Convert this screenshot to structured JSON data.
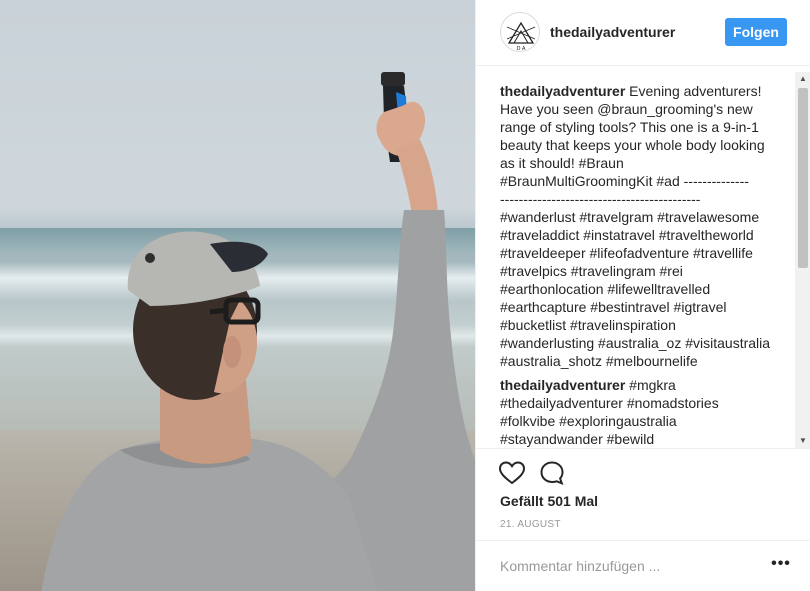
{
  "post": {
    "username": "thedailyadventurer",
    "follow_label": "Folgen",
    "avatar_text": "D A"
  },
  "comments": [
    {
      "username": "thedailyadventurer",
      "lines": [
        "Evening adventurers!",
        "Have you seen @braun_grooming's new",
        "range of styling tools? This one is a 9-in-1",
        "beauty that keeps your whole body looking",
        "as it should! #Braun",
        "#BraunMultiGroomingKit #ad --------------",
        "-------------------------------------------",
        "#wanderlust #travelgram #travelawesome",
        "#traveladdict #instatravel #traveltheworld",
        "#traveldeeper #lifeofadventure #travellife",
        "#travelpics #travelingram #rei",
        "#earthonlocation #lifewelltravelled",
        "#earthcapture #bestintravel #igtravel",
        "#bucketlist #travelinspiration",
        "#wanderlusting #australia_oz #visitaustralia",
        "#australia_shotz #melbournelife"
      ]
    },
    {
      "username": "thedailyadventurer",
      "lines": [
        "#mgkra",
        "#thedailyadventurer #nomadstories",
        "#folkvibe #exploringaustralia",
        "#stayandwander #bewild"
      ]
    }
  ],
  "actions": {
    "like_icon": "heart-icon",
    "comment_icon": "speech-bubble-icon",
    "likes_text": "Gefällt 501 Mal",
    "date_text": "21. AUGUST"
  },
  "add_comment": {
    "placeholder": "Kommentar hinzufügen ...",
    "more_label": "•••"
  },
  "scrollbar": {
    "up_arrow": "▲",
    "down_arrow": "▼"
  }
}
